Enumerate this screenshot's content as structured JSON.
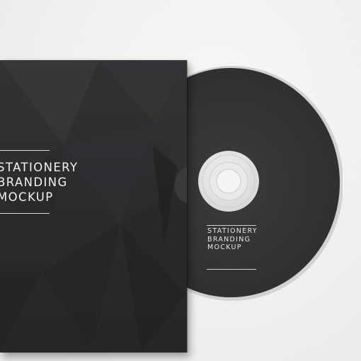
{
  "disc": {
    "lines": [
      "STATIONERY",
      "BRANDING",
      "MOCKUP"
    ]
  },
  "sleeve": {
    "lines": [
      "STATIONERY",
      "BRANDING",
      "MOCKUP"
    ]
  },
  "colors": {
    "background": "#efefed",
    "sleeve": "#2b2c2e",
    "disc": "#343537",
    "hub": "#e4e4e2",
    "text": "#f2f2f2"
  }
}
